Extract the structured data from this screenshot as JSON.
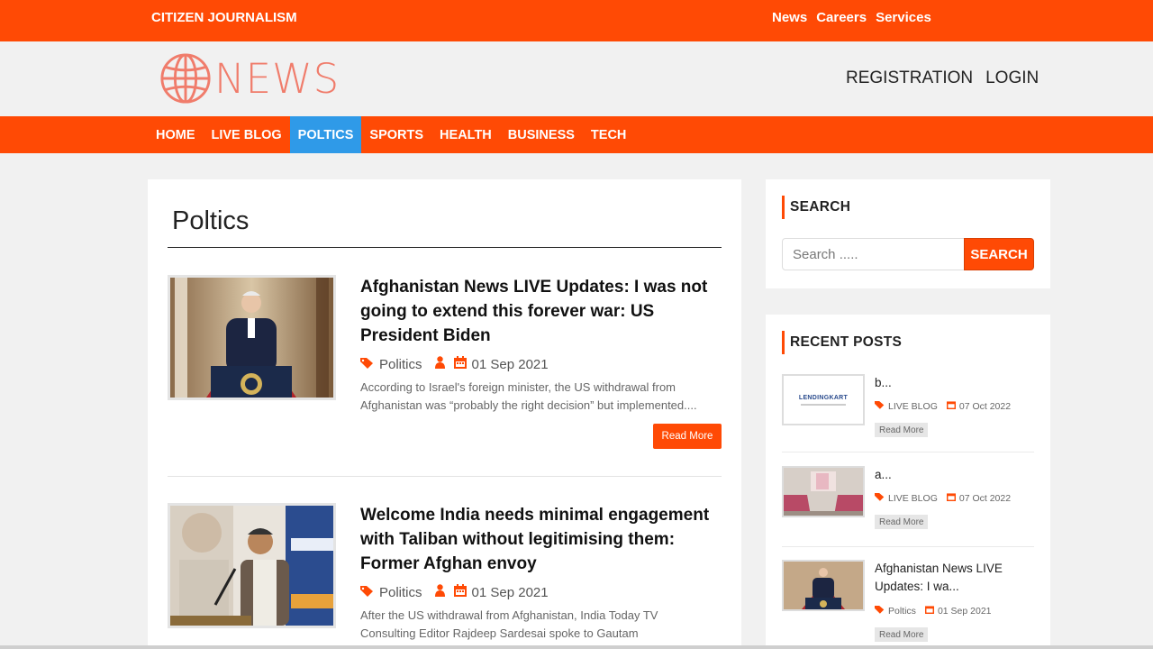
{
  "topbar": {
    "brand": "CITIZEN JOURNALISM",
    "links": [
      "News",
      "Careers",
      "Services"
    ]
  },
  "header": {
    "logo_text": "NEWS",
    "registration": "REGISTRATION",
    "login": "LOGIN"
  },
  "nav": {
    "items": [
      "HOME",
      "LIVE BLOG",
      "POLTICS",
      "SPORTS",
      "HEALTH",
      "BUSINESS",
      "TECH"
    ],
    "active_index": 2
  },
  "main": {
    "heading": "Poltics",
    "posts": [
      {
        "title": "Afghanistan News LIVE Updates: I was not going to extend this forever war: US President Biden",
        "category": "Politics",
        "date": "01 Sep 2021",
        "excerpt_line1": "According to Israel's foreign minister, the US withdrawal from",
        "excerpt_line2": "Afghanistan was “probably the right decision” but implemented....",
        "read_more": "Read More"
      },
      {
        "title": "Welcome India needs minimal engagement with Taliban without legitimising them: Former Afghan envoy",
        "category": "Politics",
        "date": "01 Sep 2021",
        "excerpt_line1": "After the US withdrawal from Afghanistan, India Today TV",
        "excerpt_line2": "Consulting Editor Rajdeep Sardesai spoke to Gautam"
      }
    ]
  },
  "sidebar": {
    "search": {
      "title": "SEARCH",
      "placeholder": "Search .....",
      "button": "SEARCH"
    },
    "recent": {
      "title": "RECENT POSTS",
      "thumb_text": "LENDINGKART",
      "posts": [
        {
          "title": "b...",
          "category": "LIVE BLOG",
          "date": "07 Oct 2022",
          "read_more": "Read More"
        },
        {
          "title": "a...",
          "category": "LIVE BLOG",
          "date": "07 Oct 2022",
          "read_more": "Read More"
        },
        {
          "title": "Afghanistan News LIVE Updates: I wa...",
          "category": "Poltics",
          "date": "01 Sep 2021",
          "read_more": "Read More"
        }
      ]
    }
  },
  "colors": {
    "brand": "#ff4a05",
    "active_nav": "#2f9ae8",
    "logo": "#f07c6b"
  }
}
